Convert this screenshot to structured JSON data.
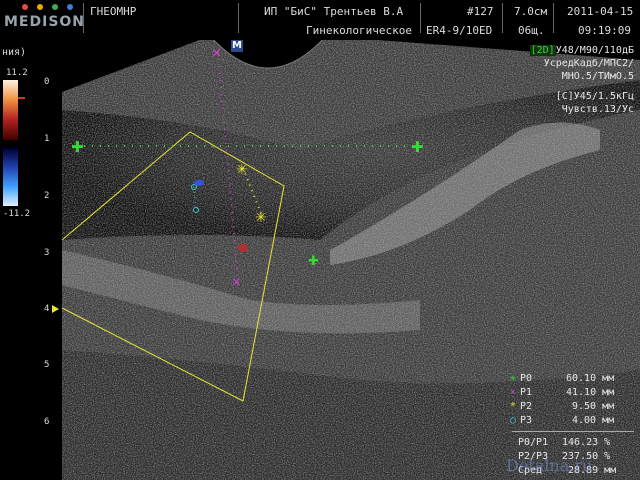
{
  "header": {
    "brand": "MEDISON",
    "brand_dot_colors": [
      "#e84a3c",
      "#f2a800",
      "#3bb04a",
      "#3c7fd8"
    ],
    "patient": "ГНЕОМНР",
    "clinic": "ИП \"БиС\" Трентьев В.А",
    "department": "Гинекологическое",
    "exam_number": "#127",
    "depth": "7.0см",
    "preset": "06щ.",
    "probe": "ER4-9/10ED",
    "date": "2011-04-15",
    "time": "09:19:09"
  },
  "left_panel": {
    "label": "ния)",
    "color_top": "11.2",
    "color_bottom": "-11.2",
    "depth_ticks": [
      "0",
      "1",
      "2",
      "3",
      "4",
      "5",
      "6"
    ]
  },
  "settings": {
    "mode": "[2D]",
    "line1": "У48/М90/110дБ",
    "line2": "УсредКадб/МПС2/",
    "line3": "МНО.5/ТИмО.5",
    "color_mode": "[C]",
    "line4": "У45/1.5кГц",
    "line5": "Чувств.13/Ус"
  },
  "markers": {
    "m_label": "M"
  },
  "measurements": [
    {
      "label": "Р0",
      "value": "60.10 мм",
      "marker": "+",
      "color": "#33dd33"
    },
    {
      "label": "Р1",
      "value": "41.10 мм",
      "marker": "×",
      "color": "#cc44cc"
    },
    {
      "label": "Р2",
      "value": "9.50 мм",
      "marker": "*",
      "color": "#e6e633"
    },
    {
      "label": "Р3",
      "value": "4.00 мм",
      "marker": "○",
      "color": "#33cccc"
    }
  ],
  "ratios": [
    {
      "label": "Р0/Р1",
      "value": "146.23 %"
    },
    {
      "label": "Р2/Р3",
      "value": "237.50 %"
    },
    {
      "label": "Сред",
      "value": "28.89 мм"
    }
  ],
  "watermark": "Detalna.ru"
}
